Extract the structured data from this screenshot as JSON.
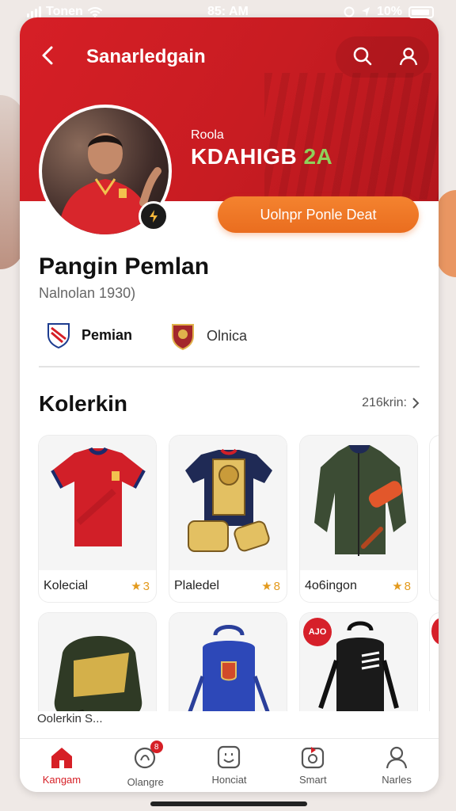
{
  "status_bar": {
    "carrier": "Tonen",
    "time": "85: AM",
    "battery": "10%"
  },
  "header": {
    "title": "Sanarledgain"
  },
  "profile": {
    "small_label": "Roola",
    "code_text": "KDAHIGB",
    "code_accent": "2A",
    "action_button": "Uolnpr Ponle Deat",
    "name": "Pangin Pemlan",
    "subtitle": "Nalnolan 1930)",
    "clubs": [
      {
        "label": "Pemian",
        "icon": "shield-crest-icon"
      },
      {
        "label": "Olnica",
        "icon": "club-crest-icon"
      }
    ]
  },
  "collection": {
    "title": "Kolerkin",
    "more_label": "216krin:",
    "items": [
      {
        "label": "Kolecial",
        "rating": "3",
        "image": "red-jersey"
      },
      {
        "label": "Plaledel",
        "rating": "8",
        "image": "gold-armor-kit"
      },
      {
        "label": "4o6ingon",
        "rating": "8",
        "image": "green-jacket"
      },
      {
        "label": "",
        "rating": "",
        "image": "olive-gold-backpack"
      },
      {
        "label": "",
        "rating": "",
        "image": "blue-backpack"
      },
      {
        "label": "",
        "rating": "",
        "image": "black-backpack",
        "badge": "AJO"
      }
    ],
    "footer_hint": "Oolerkin S..."
  },
  "bottom_nav": [
    {
      "label": "Kangam",
      "icon": "home-icon",
      "active": true
    },
    {
      "label": "Olangre",
      "icon": "trophy-badge-icon",
      "badge": "8"
    },
    {
      "label": "Honciat",
      "icon": "chat-icon"
    },
    {
      "label": "Smart",
      "icon": "smart-icon"
    },
    {
      "label": "Narles",
      "icon": "profile-icon"
    }
  ],
  "colors": {
    "brand_red": "#d61f26",
    "cta_orange": "#f07828",
    "accent_green": "#8fd15a"
  }
}
